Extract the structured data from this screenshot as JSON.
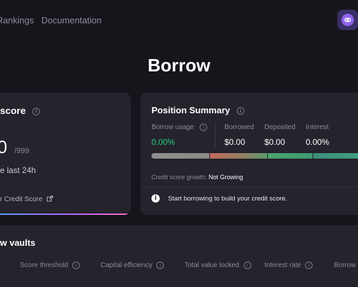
{
  "nav": {
    "rankings": "Rankings",
    "documentation": "Documentation"
  },
  "avatar_icon": "link-icon",
  "page_title": "Borrow",
  "credit_card": {
    "title": "score",
    "score": "0",
    "score_max": "/999",
    "change_text": "e last 24h",
    "link_label": "r Credit Score"
  },
  "position_summary": {
    "title": "Position Summary",
    "borrow_usage_label": "Borrow usage",
    "borrow_usage_value": "0.00%",
    "borrowed_label": "Borrowed",
    "borrowed_value": "$0.00",
    "deposited_label": "Deposited",
    "deposited_value": "$0.00",
    "interest_label": "Interest",
    "interest_value": "0.00%",
    "growth_label": "Credit score growth:",
    "growth_value": "Not Growing",
    "notice": "Start borrowing to build your credit score."
  },
  "vaults": {
    "title": "w vaults",
    "columns": [
      "Score threshold",
      "Capital efficiency",
      "Total value locked",
      "Interest rate",
      "Borrow u"
    ]
  },
  "colors": {
    "background": "#17151c",
    "card": "#25232c",
    "accent_green": "#2bd07f",
    "bar_gray": "#8f9190",
    "bar_red": "#c06a5a",
    "bar_green": "#4ba56e",
    "bar_teal": "#3b8f7a"
  }
}
